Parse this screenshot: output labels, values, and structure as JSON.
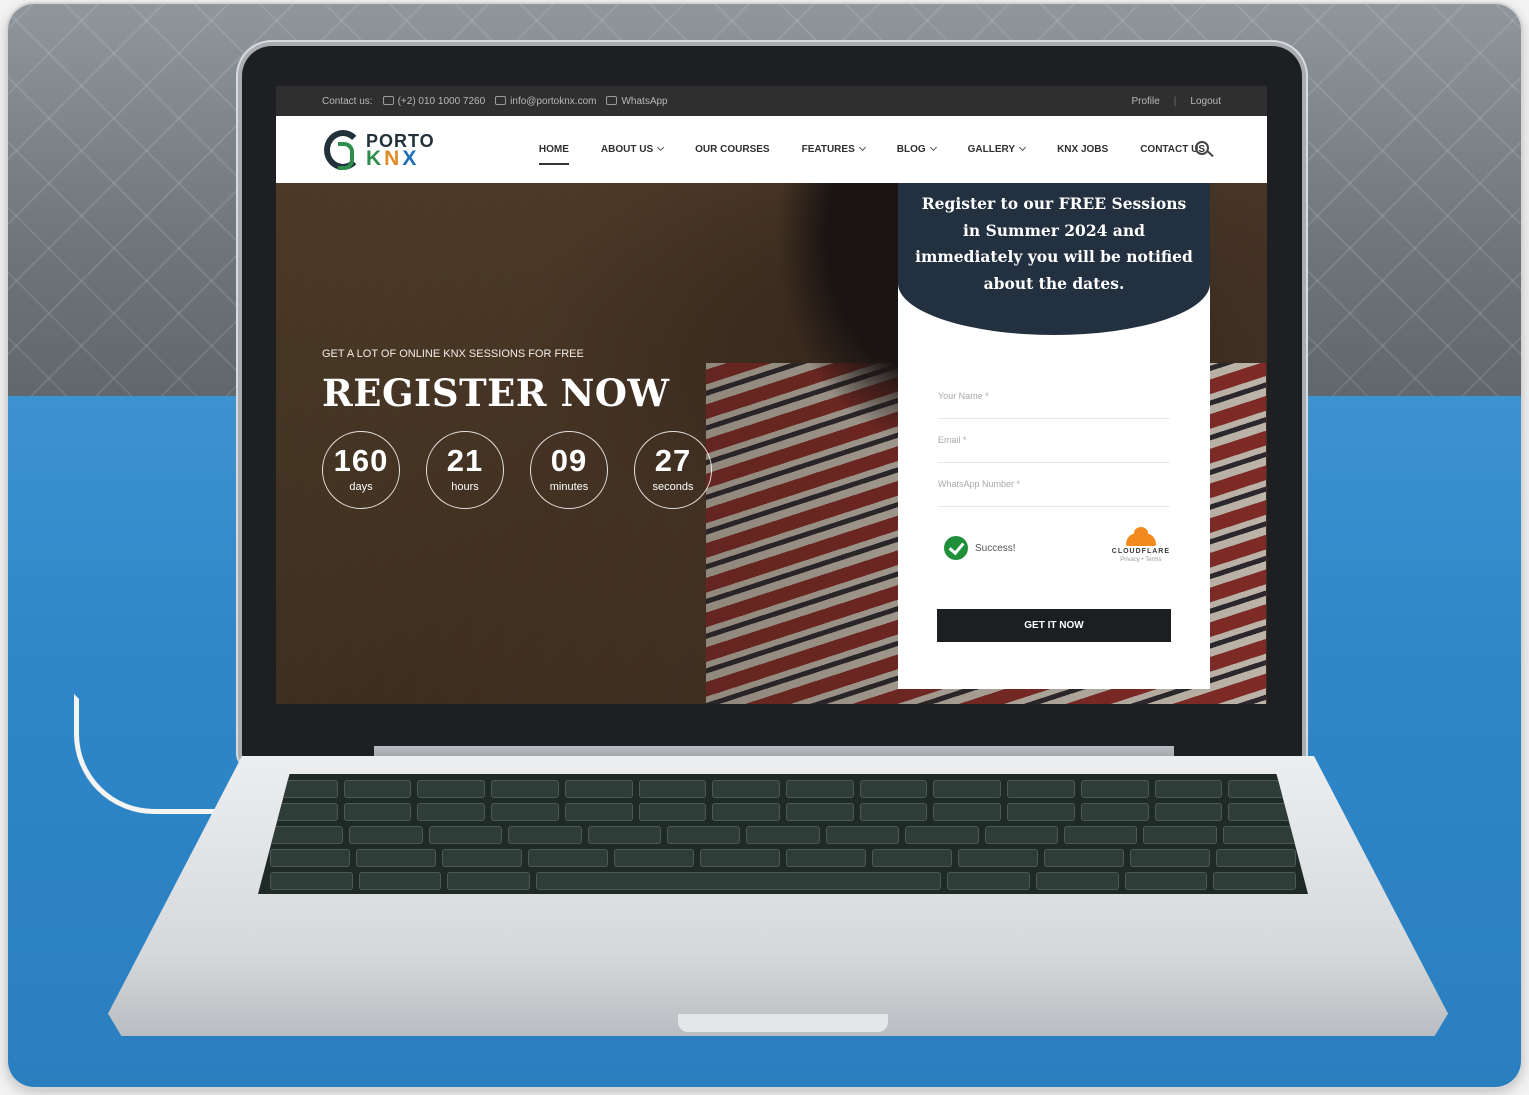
{
  "topbar": {
    "contact_label": "Contact us:",
    "phone": "(+2) 010 1000 7260",
    "email": "info@portoknx.com",
    "whatsapp": "WhatsApp",
    "profile": "Profile",
    "divider": "|",
    "logout": "Logout"
  },
  "logo": {
    "line1": "PORTO",
    "k": "K",
    "n": "N",
    "x": "X"
  },
  "nav": {
    "items": [
      {
        "label": "HOME",
        "active": true
      },
      {
        "label": "ABOUT US",
        "dropdown": true
      },
      {
        "label": "OUR COURSES"
      },
      {
        "label": "FEATURES",
        "dropdown": true
      },
      {
        "label": "BLOG",
        "dropdown": true
      },
      {
        "label": "GALLERY",
        "dropdown": true
      },
      {
        "label": "KNX JOBS"
      },
      {
        "label": "CONTACT US"
      }
    ],
    "search_icon": "search-icon"
  },
  "hero": {
    "kicker": "GET A LOT OF ONLINE KNX SESSIONS FOR FREE",
    "headline": "REGISTER NOW",
    "countdown": [
      {
        "value": "160",
        "unit": "days"
      },
      {
        "value": "21",
        "unit": "hours"
      },
      {
        "value": "09",
        "unit": "minutes"
      },
      {
        "value": "27",
        "unit": "seconds"
      }
    ]
  },
  "form": {
    "heading": "Register to our FREE Sessions in Summer 2024  and immediately you will be notified about the dates.",
    "name_placeholder": "Your Name *",
    "email_placeholder": "Email *",
    "whatsapp_placeholder": "WhatsApp Number *",
    "captcha_status": "Success!",
    "captcha_brand": "CLOUDFLARE",
    "captcha_links": "Privacy  •  Terms",
    "submit": "GET IT NOW"
  },
  "colors": {
    "panel_header": "#23303f",
    "button": "#1b1f22",
    "success": "#1f8f3a",
    "logo_green": "#2c8e4a",
    "logo_orange": "#e08b2a",
    "logo_blue": "#1e6fb8"
  }
}
